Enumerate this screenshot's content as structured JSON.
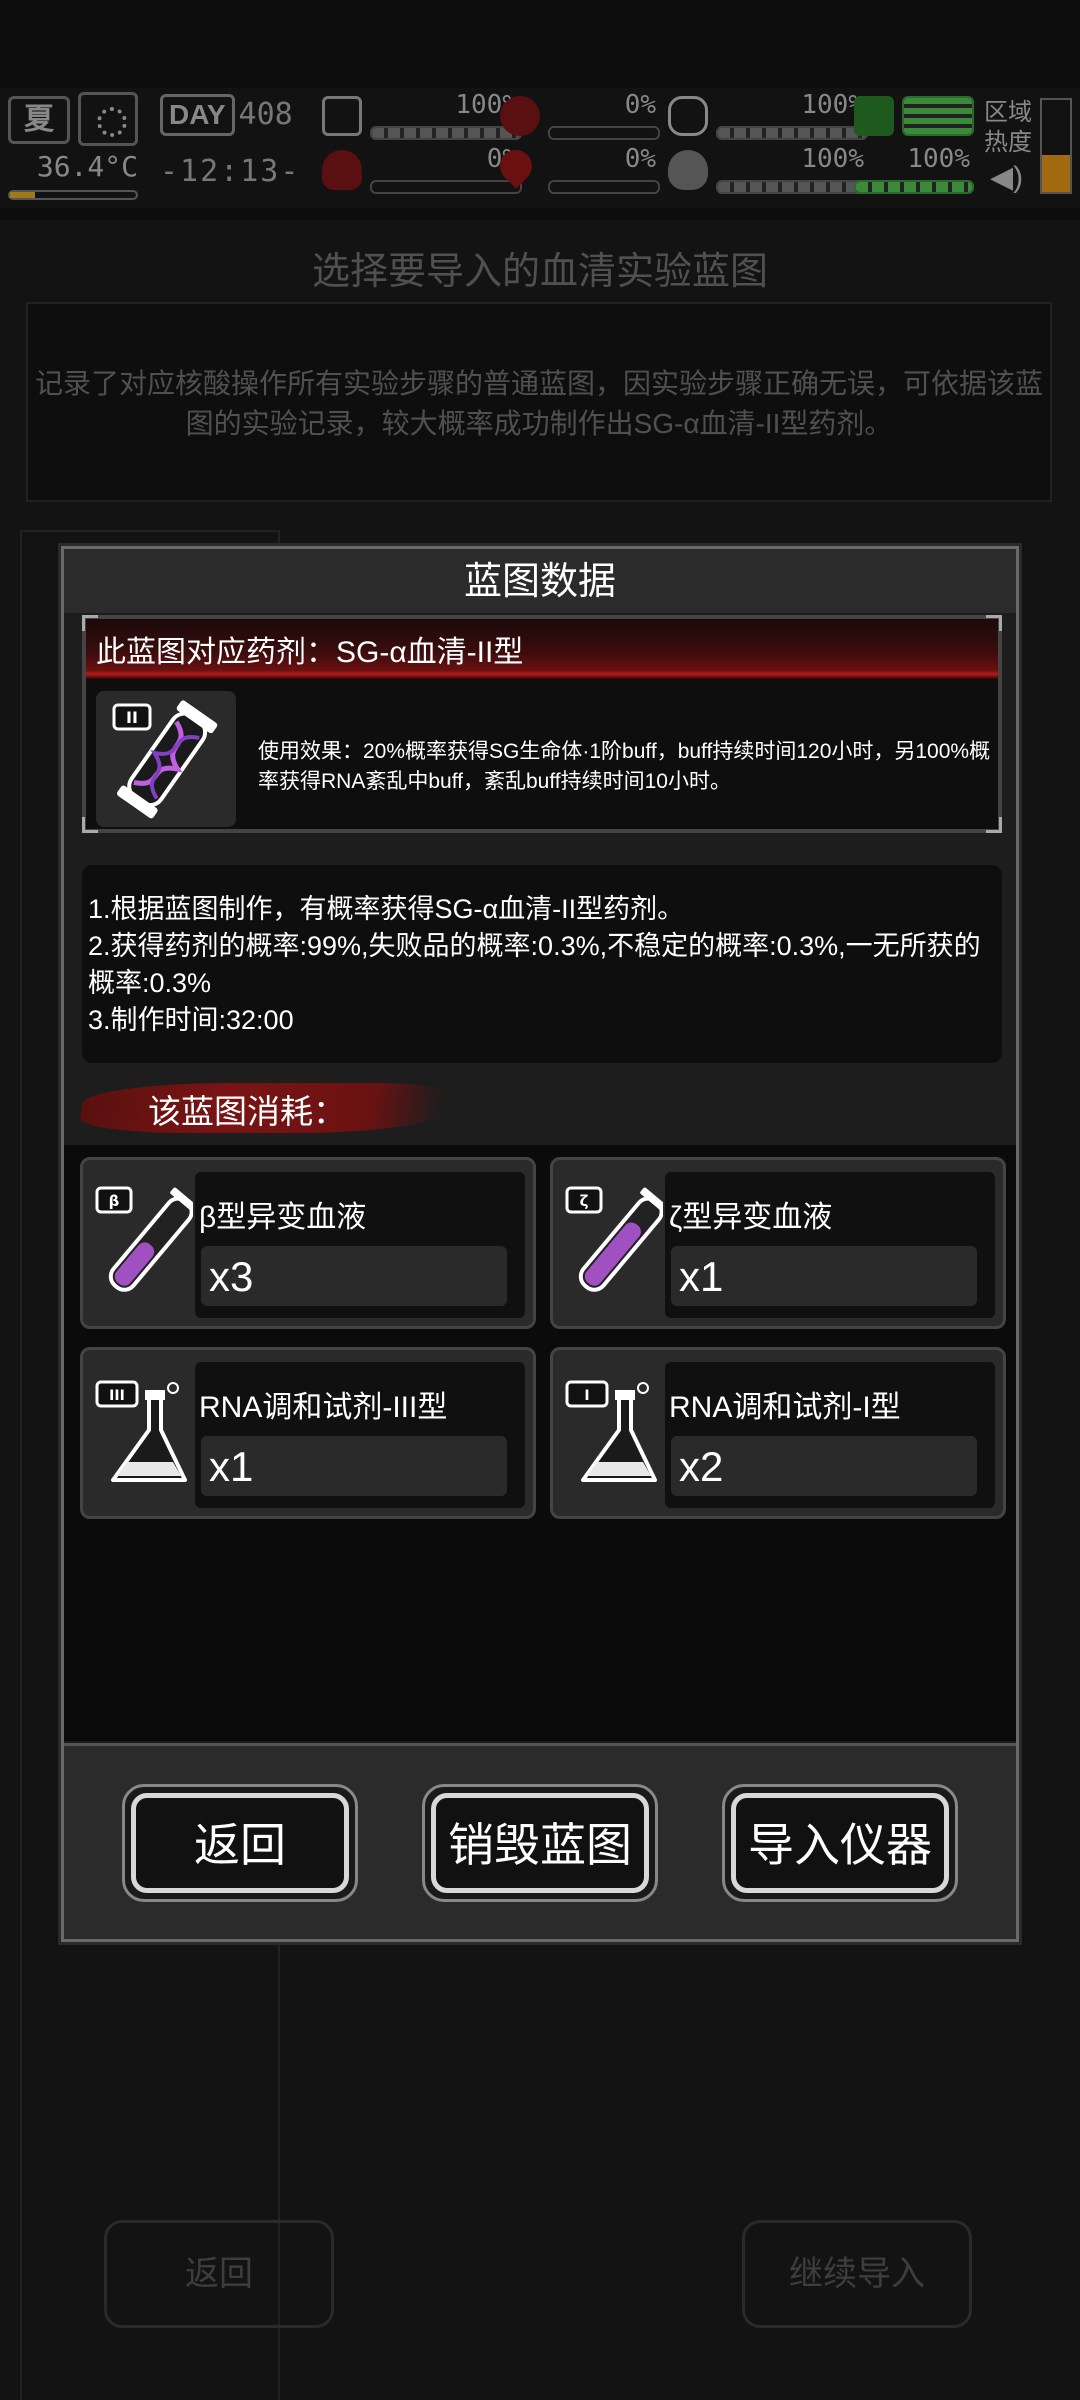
{
  "hud": {
    "season": "夏",
    "temperature": "36.4°C",
    "day_label": "DAY",
    "day_number": "408",
    "time": "-12:13-",
    "stats": [
      {
        "icon": "medkit-icon",
        "value": "100%",
        "level": 1.0
      },
      {
        "icon": "stomach-icon",
        "value": "0%",
        "level": 0.0
      },
      {
        "icon": "mask-icon",
        "value": "100%",
        "level": 1.0
      },
      {
        "icon": "radiation-icon",
        "value": "100%",
        "level": 1.0
      },
      {
        "icon": "brain-icon",
        "value": "0%",
        "level": 0.0
      },
      {
        "icon": "blood-drop-icon",
        "value": "0%",
        "level": 0.0
      },
      {
        "icon": "heart-icon",
        "value": "100%",
        "level": 1.0
      },
      {
        "icon": "energy-icon",
        "value": "100%",
        "level": 1.0
      }
    ],
    "region_label": "区域热度"
  },
  "background": {
    "title": "选择要导入的血清实验蓝图",
    "description": "记录了对应核酸操作所有实验步骤的普通蓝图，因实验步骤正确无误，可依据该蓝图的实验记录，较大概率成功制作出SG-α血清-II型药剂。",
    "back_button": "返回",
    "continue_button": "继续导入"
  },
  "modal": {
    "title": "蓝图数据",
    "drug": {
      "name": "此蓝图对应药剂：SG-α血清-II型",
      "icon_badge": "II",
      "effect": "使用效果：20%概率获得SG生命体·1阶buff，buff持续时间120小时，另100%概率获得RNA紊乱中buff，紊乱buff持续时间10小时。"
    },
    "info_lines": [
      "1.根据蓝图制作，有概率获得SG-α血清-II型药剂。",
      "2.获得药剂的概率:99%,失败品的概率:0.3%,不稳定的概率:0.3%,一无所获的概率:0.3%",
      "3.制作时间:32:00"
    ],
    "consume_header": "该蓝图消耗：",
    "items": [
      {
        "name": "β型异变血液",
        "qty": "x3",
        "badge": "β",
        "icon": "blood-vial-icon"
      },
      {
        "name": "ζ型异变血液",
        "qty": "x1",
        "badge": "ζ",
        "icon": "blood-vial-icon"
      },
      {
        "name": "RNA调和试剂-III型",
        "qty": "x1",
        "badge": "III",
        "icon": "flask-icon"
      },
      {
        "name": "RNA调和试剂-I型",
        "qty": "x2",
        "badge": "I",
        "icon": "flask-icon"
      }
    ],
    "buttons": {
      "back": "返回",
      "destroy": "销毁蓝图",
      "import": "导入仪器"
    }
  }
}
